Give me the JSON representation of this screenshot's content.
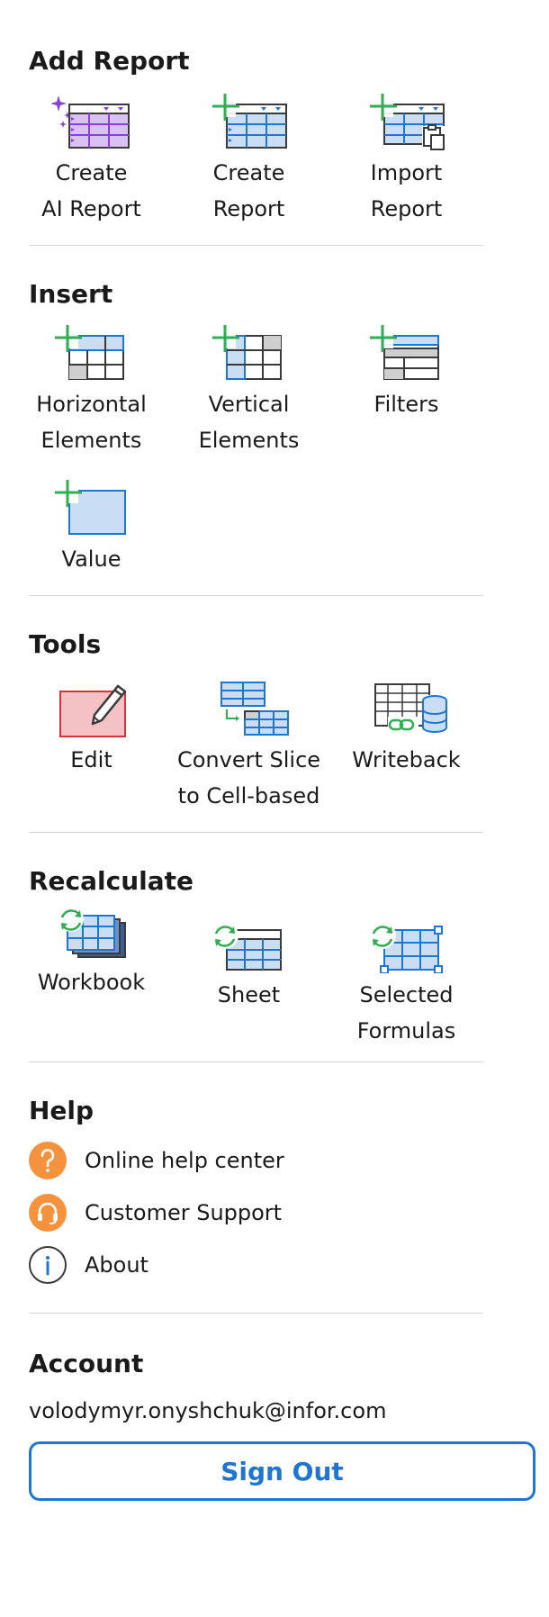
{
  "add_report": {
    "title": "Add Report",
    "items": [
      {
        "line1": "Create",
        "line2": "AI Report",
        "icon": "ai-report-icon"
      },
      {
        "line1": "Create",
        "line2": "Report",
        "icon": "create-report-icon"
      },
      {
        "line1": "Import",
        "line2": "Report",
        "icon": "import-report-icon"
      }
    ]
  },
  "insert": {
    "title": "Insert",
    "items": [
      {
        "line1": "Horizontal",
        "line2": "Elements",
        "icon": "horizontal-elements-icon"
      },
      {
        "line1": "Vertical",
        "line2": "Elements",
        "icon": "vertical-elements-icon"
      },
      {
        "line1": "Filters",
        "line2": "",
        "icon": "filters-icon"
      },
      {
        "line1": "Value",
        "line2": "",
        "icon": "value-icon"
      }
    ]
  },
  "tools": {
    "title": "Tools",
    "items": [
      {
        "line1": "Edit",
        "line2": "",
        "icon": "edit-icon"
      },
      {
        "line1": "Convert Slice",
        "line2": "to Cell-based",
        "icon": "convert-slice-icon"
      },
      {
        "line1": "Writeback",
        "line2": "",
        "icon": "writeback-icon"
      }
    ]
  },
  "recalculate": {
    "title": "Recalculate",
    "items": [
      {
        "line1": "Workbook",
        "line2": "",
        "icon": "workbook-recalc-icon"
      },
      {
        "line1": "Sheet",
        "line2": "",
        "icon": "sheet-recalc-icon"
      },
      {
        "line1": "Selected",
        "line2": "Formulas",
        "icon": "selected-formulas-icon"
      }
    ]
  },
  "help": {
    "title": "Help",
    "items": [
      {
        "label": "Online help center",
        "icon": "question-icon"
      },
      {
        "label": "Customer Support",
        "icon": "headset-icon"
      },
      {
        "label": "About",
        "icon": "info-icon"
      }
    ]
  },
  "account": {
    "title": "Account",
    "email": "volodymyr.onyshchuk@infor.com",
    "sign_out_label": "Sign Out"
  },
  "colors": {
    "accent": "#1f76d1",
    "green": "#2fae52",
    "purple": "#8a3fd9",
    "orange": "#f5923e",
    "divider": "#d6d6d6"
  }
}
